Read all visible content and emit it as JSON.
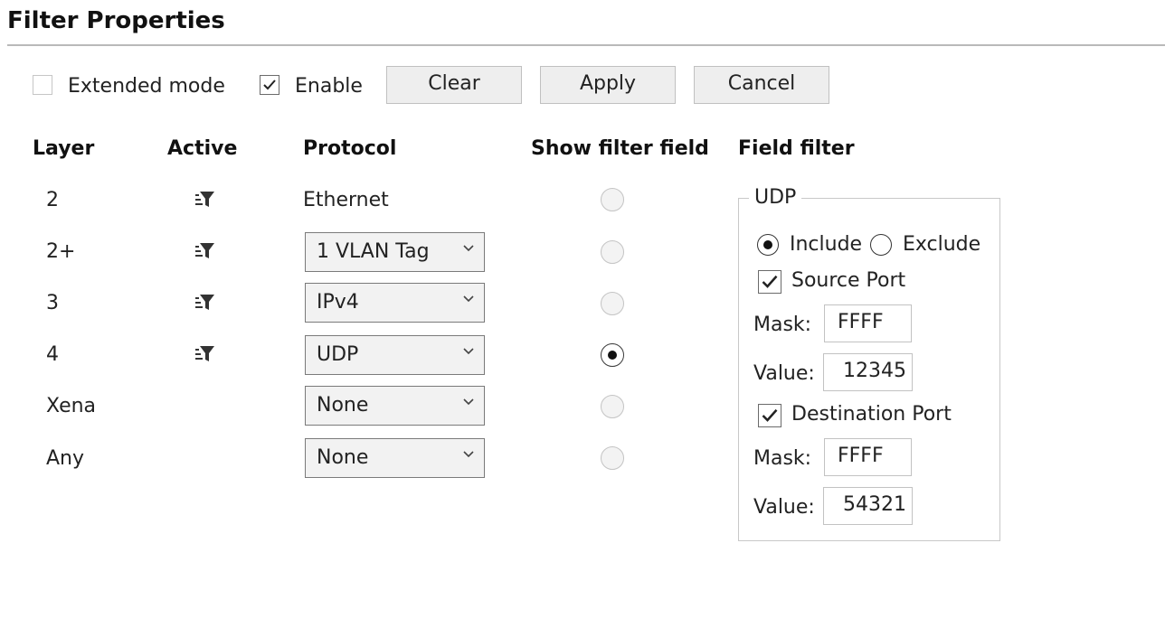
{
  "title": "Filter Properties",
  "toolbar": {
    "extended_mode_label": "Extended mode",
    "extended_mode_checked": false,
    "enable_label": "Enable",
    "enable_checked": true,
    "clear_label": "Clear",
    "apply_label": "Apply",
    "cancel_label": "Cancel"
  },
  "columns": {
    "layer": "Layer",
    "active": "Active",
    "protocol": "Protocol",
    "show_filter_field": "Show filter field",
    "field_filter": "Field filter"
  },
  "rows": [
    {
      "layer": "2",
      "active_icon": "filter-icon",
      "protocol": "Ethernet",
      "protocol_is_select": false,
      "show_filter_field": false
    },
    {
      "layer": "2+",
      "active_icon": "filter-icon",
      "protocol": "1 VLAN Tag",
      "protocol_is_select": true,
      "show_filter_field": false
    },
    {
      "layer": "3",
      "active_icon": "filter-icon",
      "protocol": "IPv4",
      "protocol_is_select": true,
      "show_filter_field": false
    },
    {
      "layer": "4",
      "active_icon": "filter-icon",
      "protocol": "UDP",
      "protocol_is_select": true,
      "show_filter_field": true
    },
    {
      "layer": "Xena",
      "active_icon": "",
      "protocol": "None",
      "protocol_is_select": true,
      "show_filter_field": false
    },
    {
      "layer": "Any",
      "active_icon": "",
      "protocol": "None",
      "protocol_is_select": true,
      "show_filter_field": false
    }
  ],
  "field_filter": {
    "group_title": "UDP",
    "include_label": "Include",
    "exclude_label": "Exclude",
    "mode": "Include",
    "source_port": {
      "label": "Source Port",
      "checked": true,
      "mask_label": "Mask:",
      "mask": "FFFF",
      "value_label": "Value:",
      "value": "12345"
    },
    "destination_port": {
      "label": "Destination Port",
      "checked": true,
      "mask_label": "Mask:",
      "mask": "FFFF",
      "value_label": "Value:",
      "value": "54321"
    }
  }
}
